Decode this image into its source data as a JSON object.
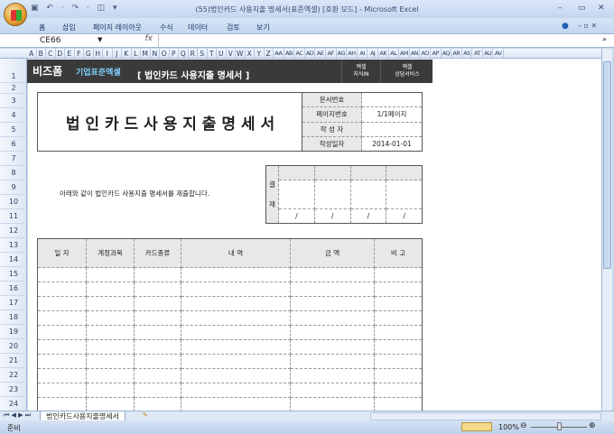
{
  "window": {
    "title": "(55)법인카드 사용지출 명세서(표준엑셀) [호환 모드] - Microsoft Excel",
    "qat": "▣ ↶ · ↷ · ◫ ▾"
  },
  "ribbon": {
    "tabs": [
      "홈",
      "삽입",
      "페이지 레이아웃",
      "수식",
      "데이터",
      "검토",
      "보기"
    ]
  },
  "formula_bar": {
    "name_box": "CE66",
    "fx": "fx",
    "value": ""
  },
  "columns": [
    "A",
    "B",
    "C",
    "D",
    "E",
    "F",
    "G",
    "H",
    "I",
    "J",
    "K",
    "L",
    "M",
    "N",
    "O",
    "P",
    "Q",
    "R",
    "S",
    "T",
    "U",
    "V",
    "W",
    "X",
    "Y",
    "Z",
    "AA",
    "AB",
    "AC",
    "AD",
    "AE",
    "AF",
    "AG",
    "AH",
    "AI",
    "AJ",
    "AK",
    "AL",
    "AM",
    "AN",
    "AO",
    "AP",
    "AQ",
    "AR",
    "AS",
    "AT",
    "AU",
    "AV"
  ],
  "rows": [
    "1",
    "2",
    "3",
    "4",
    "5",
    "6",
    "7",
    "8",
    "9",
    "10",
    "11",
    "12",
    "13",
    "14",
    "15",
    "16",
    "17",
    "18",
    "19",
    "20",
    "21",
    "22",
    "23",
    "24"
  ],
  "banner": {
    "logo": "비즈폼",
    "brand": "기업표준엑셀",
    "title": "[ 법인카드 사용지출 명세서 ]",
    "btn1_l1": "엑셀",
    "btn1_l2": "지식IN",
    "btn2_l1": "엑셀",
    "btn2_l2": "상담서비스"
  },
  "doc": {
    "title": "법 인 카 드 사 용 지 출 명 세 서",
    "info": [
      {
        "label": "문서번호",
        "value": ""
      },
      {
        "label": "페이지번호",
        "value": "1/1페이지"
      },
      {
        "label": "작 성 자",
        "value": ""
      },
      {
        "label": "작성일자",
        "value": "2014-01-01"
      }
    ],
    "sentence": "아래와 같이  법인카드 사용지출 명세서를 제출합니다.",
    "approval": {
      "label1": "결",
      "label2": "재",
      "date_mark": "/"
    },
    "table": {
      "headers": [
        "일  자",
        "계정과목",
        "카드종류",
        "내          역",
        "금       액",
        "비    고"
      ]
    }
  },
  "sheet_tab": "법인카드사용지출명세서",
  "status": {
    "ready": "준비",
    "zoom": "100%"
  }
}
